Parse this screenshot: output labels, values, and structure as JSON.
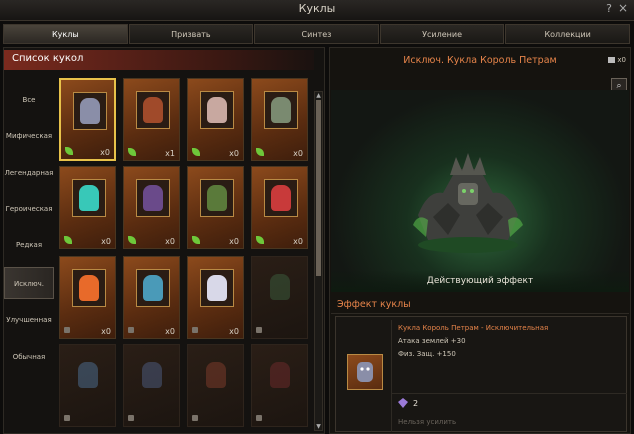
{
  "window": {
    "title": "Куклы",
    "help": "?",
    "close": "×"
  },
  "tabs": [
    {
      "label": "Куклы",
      "active": true
    },
    {
      "label": "Призвать"
    },
    {
      "label": "Синтез"
    },
    {
      "label": "Усиление"
    },
    {
      "label": "Коллекции"
    }
  ],
  "list": {
    "title": "Список кукол"
  },
  "categories": [
    {
      "label": "Все"
    },
    {
      "label": "Мифическая"
    },
    {
      "label": "Легендарная"
    },
    {
      "label": "Героическая"
    },
    {
      "label": "Редкая"
    },
    {
      "label": "Исключ.",
      "active": true
    },
    {
      "label": "Улучшенная"
    },
    {
      "label": "Обычная"
    }
  ],
  "cards": [
    {
      "count": "x0",
      "owned": true,
      "selected": true,
      "color": "#8a8ea8"
    },
    {
      "count": "x1",
      "owned": true,
      "color": "#a04a2a"
    },
    {
      "count": "x0",
      "owned": true,
      "color": "#c8a8a0"
    },
    {
      "count": "x0",
      "owned": true,
      "color": "#7a8a70"
    },
    {
      "count": "x0",
      "owned": true,
      "color": "#38c8b8"
    },
    {
      "count": "x0",
      "owned": true,
      "color": "#6a4a8a"
    },
    {
      "count": "x0",
      "owned": true,
      "color": "#5a7a3a"
    },
    {
      "count": "x0",
      "owned": true,
      "color": "#c83a3a"
    },
    {
      "count": "x0",
      "owned": false,
      "color": "#e86a2a"
    },
    {
      "count": "x0",
      "owned": false,
      "color": "#4a9ab8"
    },
    {
      "count": "x0",
      "owned": false,
      "color": "#d8d8e8"
    },
    {
      "count": "",
      "owned": false,
      "dim": true,
      "color": "#3a5a3a"
    },
    {
      "count": "",
      "owned": false,
      "dim": true,
      "color": "#4a6a8a"
    },
    {
      "count": "",
      "owned": false,
      "dim": true,
      "color": "#4a5a7a"
    },
    {
      "count": "",
      "owned": false,
      "dim": true,
      "color": "#7a3a2a"
    },
    {
      "count": "",
      "owned": false,
      "dim": true,
      "color": "#6a2a2a"
    }
  ],
  "detail": {
    "title": "Исключ. Кукла Король Петрам",
    "count": "x0",
    "active_effect": "Действующий эффект"
  },
  "effect": {
    "heading": "Эффект куклы",
    "name": "Кукла Король Петрам - Исключительная",
    "line1": "Атака землей +30",
    "line2": "Физ. Защ. +150",
    "gem_count": "2",
    "upgrade_note": "Нельзя усилить"
  }
}
